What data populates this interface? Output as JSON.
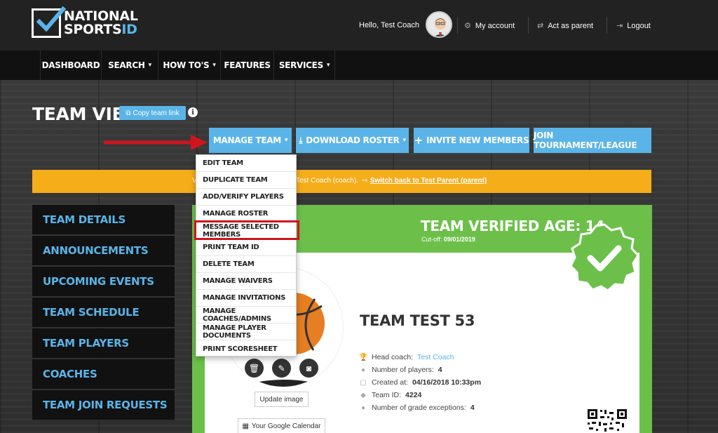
{
  "header": {
    "logo_line1": "NATIONAL",
    "logo_line2_a": "SPORTS",
    "logo_line2_b": "ID",
    "greeting": "Hello, Test Coach",
    "links": [
      {
        "label": "My account",
        "icon": "gear-icon"
      },
      {
        "label": "Act as parent",
        "icon": "swap-icon"
      },
      {
        "label": "Logout",
        "icon": "logout-icon"
      }
    ]
  },
  "nav": {
    "items": [
      {
        "label": "DASHBOARD",
        "dropdown": false
      },
      {
        "label": "SEARCH",
        "dropdown": true
      },
      {
        "label": "HOW TO'S",
        "dropdown": true
      },
      {
        "label": "FEATURES",
        "dropdown": false
      },
      {
        "label": "SERVICES",
        "dropdown": true
      }
    ]
  },
  "page": {
    "title": "TEAM VIEW",
    "copy_link": "Copy team link",
    "info_glyph": "i"
  },
  "actions": {
    "manage_team": "MANAGE TEAM",
    "download_roster": "DOWNLOAD ROSTER",
    "invite": "INVITE NEW MEMBERS",
    "join": "JOIN TOURNAMENT/LEAGUE"
  },
  "notice": {
    "text_prefix": "V",
    "text_main": "Test Coach (coach).",
    "link": "Switch back to Test Parent (parent)"
  },
  "dropdown": {
    "items": [
      "EDIT TEAM",
      "DUPLICATE TEAM",
      "ADD/VERIFY PLAYERS",
      "MANAGE ROSTER",
      "MESSAGE SELECTED MEMBERS",
      "PRINT TEAM ID",
      "DELETE TEAM",
      "MANAGE WAIVERS",
      "MANAGE INVITATIONS",
      "MANAGE COACHES/ADMINS",
      "MANAGE PLAYER DOCUMENTS",
      "PRINT SCORESHEET"
    ],
    "highlighted": "MESSAGE SELECTED MEMBERS"
  },
  "sidebar": {
    "items": [
      "TEAM DETAILS",
      "ANNOUNCEMENTS",
      "UPCOMING EVENTS",
      "TEAM SCHEDULE",
      "TEAM PLAYERS",
      "COACHES",
      "TEAM JOIN REQUESTS"
    ]
  },
  "team": {
    "verified_age": "TEAM VERIFIED AGE: 14",
    "cutoff_label": "Cut-off:",
    "cutoff_date": "09/01/2019",
    "name": "TEAM TEST 53",
    "head_coach_label": "Head coach:",
    "head_coach": "Test Coach",
    "players_label": "Number of players:",
    "players": "4",
    "created_label": "Created at:",
    "created": "04/16/2018 10:33pm",
    "team_id_label": "Team ID:",
    "team_id": "4224",
    "grade_exc_label": "Number of grade exceptions:",
    "grade_exc": "4",
    "update_image": "Update image",
    "google_calendar": "Your Google Calendar"
  },
  "colors": {
    "accent_blue": "#5ab4e8",
    "green": "#6cc04a",
    "notice": "#f5ad1a",
    "highlight_red": "#d0141d"
  }
}
